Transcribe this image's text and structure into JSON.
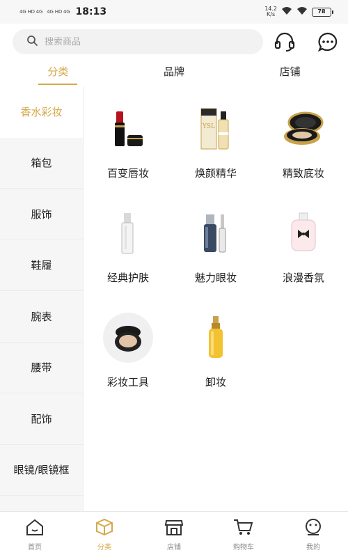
{
  "status_bar": {
    "carrier_1": "4G HD 4G",
    "carrier_2": "4G HD 4G",
    "time": "18:13",
    "net_speed_value": "14.2",
    "net_speed_unit": "K/s",
    "battery": "78"
  },
  "search": {
    "placeholder": "搜索商品"
  },
  "header_icons": [
    "headset-icon",
    "chat-icon"
  ],
  "top_tabs": [
    {
      "label": "分类",
      "active": true
    },
    {
      "label": "品牌",
      "active": false
    },
    {
      "label": "店铺",
      "active": false
    }
  ],
  "sidebar": {
    "items": [
      {
        "label": "香水彩妆",
        "active": true
      },
      {
        "label": "箱包"
      },
      {
        "label": "服饰"
      },
      {
        "label": "鞋履"
      },
      {
        "label": "腕表"
      },
      {
        "label": "腰带"
      },
      {
        "label": "配饰"
      },
      {
        "label": "眼镜/眼镜框"
      }
    ]
  },
  "categories": [
    {
      "label": "百变唇妆",
      "icon": "lipstick-icon"
    },
    {
      "label": "焕颜精华",
      "icon": "serum-box-icon"
    },
    {
      "label": "精致底妆",
      "icon": "compact-powder-icon"
    },
    {
      "label": "经典护肤",
      "icon": "skincare-bottle-icon"
    },
    {
      "label": "魅力眼妆",
      "icon": "eye-serum-icon"
    },
    {
      "label": "浪漫香氛",
      "icon": "perfume-icon"
    },
    {
      "label": "彩妆工具",
      "icon": "cushion-compact-icon"
    },
    {
      "label": "卸妆",
      "icon": "cleansing-oil-icon"
    }
  ],
  "bottom_nav": [
    {
      "label": "首页",
      "icon": "home-icon",
      "active": false
    },
    {
      "label": "分类",
      "icon": "category-box-icon",
      "active": true
    },
    {
      "label": "店铺",
      "icon": "store-icon",
      "active": false
    },
    {
      "label": "购物车",
      "icon": "cart-icon",
      "active": false
    },
    {
      "label": "我的",
      "icon": "profile-icon",
      "active": false
    }
  ],
  "colors": {
    "accent": "#d4a94a",
    "sidebar_bg": "#f6f6f6",
    "search_bg": "#f2f2f2"
  }
}
